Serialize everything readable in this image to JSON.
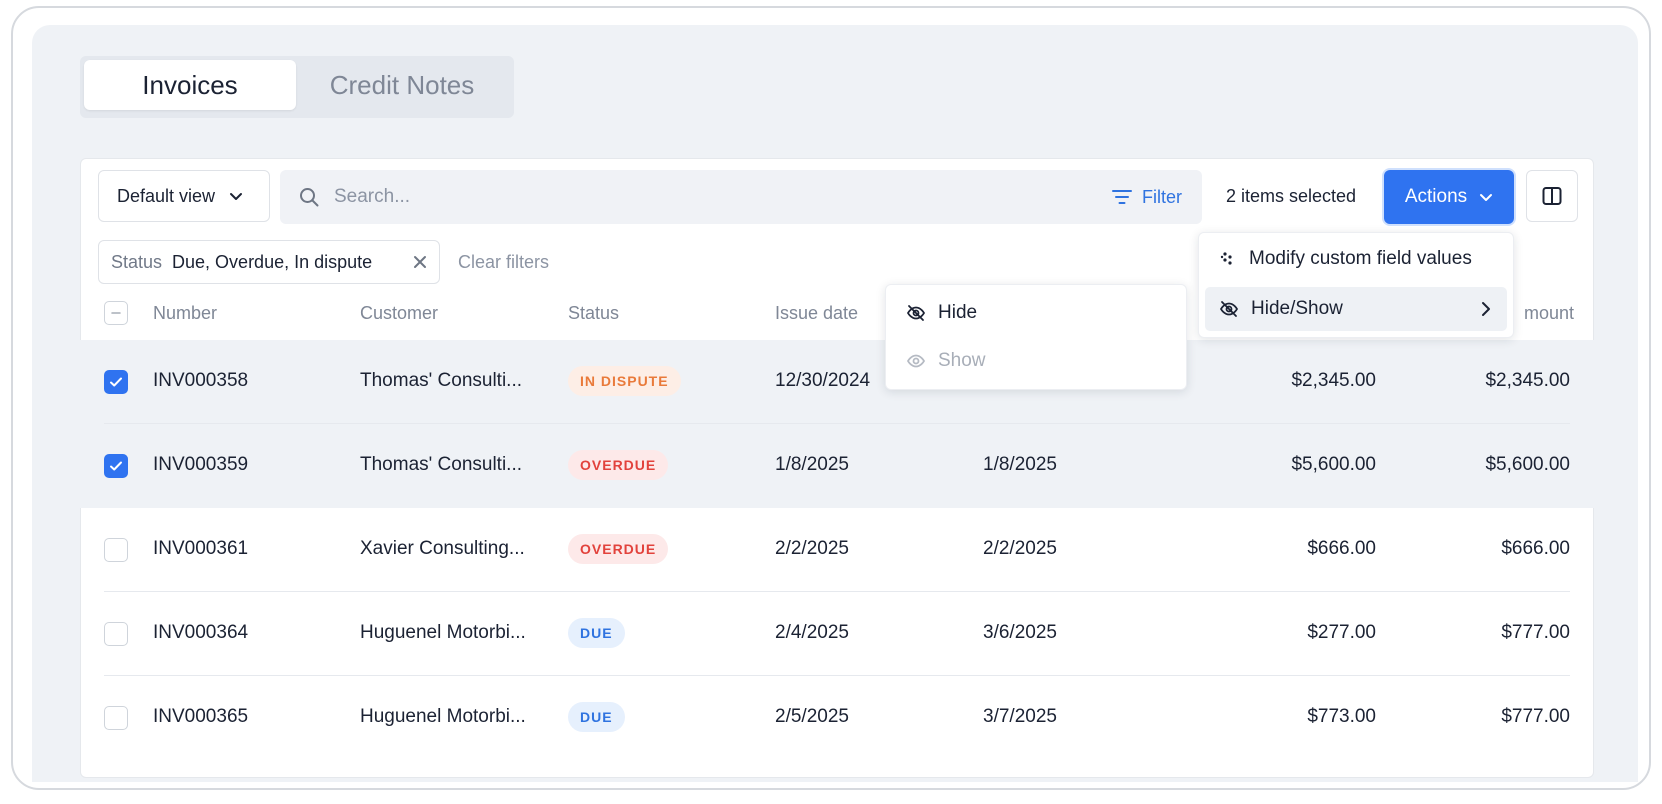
{
  "tabs": [
    {
      "label": "Invoices",
      "active": true
    },
    {
      "label": "Credit Notes",
      "active": false
    }
  ],
  "toolbar": {
    "view_label": "Default view",
    "search_placeholder": "Search...",
    "filter_label": "Filter",
    "selected_count": "2 items selected",
    "actions_label": "Actions"
  },
  "filters": {
    "chip_key": "Status",
    "chip_value": "Due, Overdue, In dispute",
    "clear_label": "Clear filters"
  },
  "table": {
    "headers": {
      "number": "Number",
      "customer": "Customer",
      "status": "Status",
      "issue_date": "Issue date",
      "amount": "mount"
    },
    "rows": [
      {
        "number": "INV000358",
        "customer": "Thomas' Consulti...",
        "status": "IN DISPUTE",
        "issue": "12/30/2024",
        "due": "",
        "amount1": "$2,345.00",
        "amount2": "$2,345.00",
        "selected": true
      },
      {
        "number": "INV000359",
        "customer": "Thomas' Consulti...",
        "status": "OVERDUE",
        "issue": "1/8/2025",
        "due": "1/8/2025",
        "amount1": "$5,600.00",
        "amount2": "$5,600.00",
        "selected": true
      },
      {
        "number": "INV000361",
        "customer": "Xavier Consulting...",
        "status": "OVERDUE",
        "issue": "2/2/2025",
        "due": "2/2/2025",
        "amount1": "$666.00",
        "amount2": "$666.00",
        "selected": false
      },
      {
        "number": "INV000364",
        "customer": "Huguenel Motorbi...",
        "status": "DUE",
        "issue": "2/4/2025",
        "due": "3/6/2025",
        "amount1": "$277.00",
        "amount2": "$777.00",
        "selected": false
      },
      {
        "number": "INV000365",
        "customer": "Huguenel Motorbi...",
        "status": "DUE",
        "issue": "2/5/2025",
        "due": "3/7/2025",
        "amount1": "$773.00",
        "amount2": "$777.00",
        "selected": false
      }
    ]
  },
  "actions_menu": {
    "items": [
      "Modify custom field values",
      "Hide/Show"
    ]
  },
  "submenu": {
    "items": [
      "Hide",
      "Show"
    ]
  },
  "colors": {
    "primary": "#2f73f0",
    "dispute": "#e97a3a",
    "overdue": "#e2423c",
    "due": "#2f73e0"
  }
}
